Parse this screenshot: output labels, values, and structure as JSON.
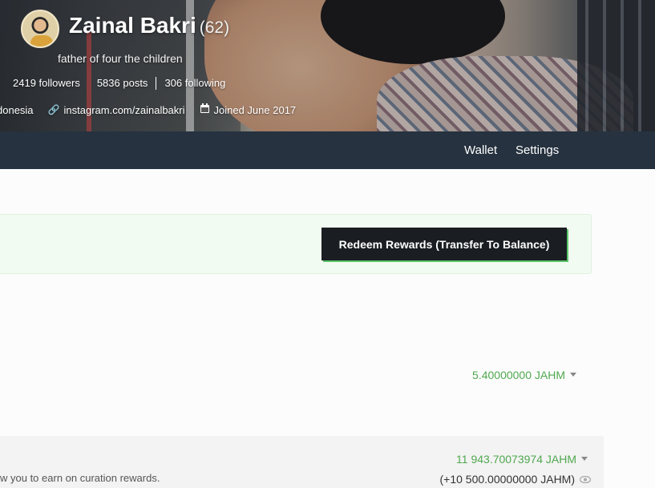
{
  "profile": {
    "name": "Zainal Bakri",
    "reputation": "(62)",
    "about": "father of four the children",
    "followers": "2419 followers",
    "posts": "5836 posts",
    "following": "306 following",
    "location": "donesia",
    "website": "instagram.com/zainalbakri",
    "joined": "Joined June 2017"
  },
  "nav": {
    "wallet": "Wallet",
    "settings": "Settings"
  },
  "rewards": {
    "redeem_label": "Redeem Rewards (Transfer To Balance)"
  },
  "balances": {
    "balance1": "5.40000000 JAHM",
    "balance2": "11 943.70073974 JAHM",
    "delegated": "(+10 500.00000000 JAHM)",
    "curation_desc": "w you to earn on curation rewards."
  },
  "icons": {
    "link": "link-icon",
    "calendar": "calendar-icon",
    "eye": "eye-icon",
    "caret": "caret-down-icon"
  }
}
